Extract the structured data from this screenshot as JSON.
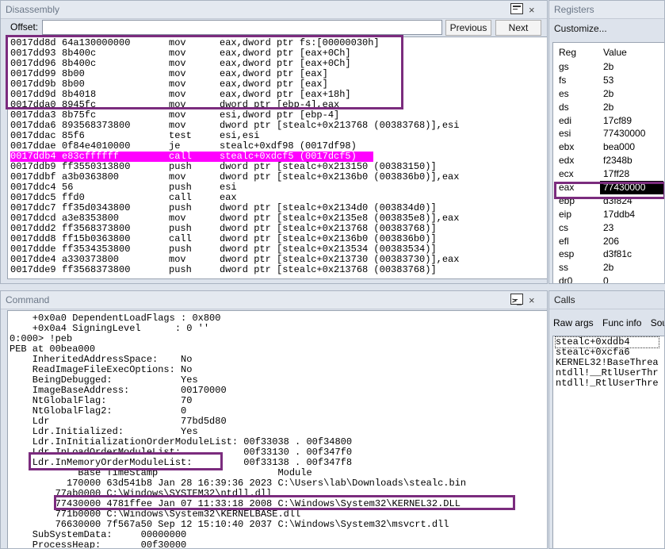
{
  "disassembly": {
    "title": "Disassembly",
    "offset_label": "Offset:",
    "offset_value": "",
    "previous_label": "Previous",
    "next_label": "Next",
    "rows": [
      {
        "addr": "0017dd8d",
        "bytes": "64a130000000",
        "mnem": "mov",
        "ops": "eax,dword ptr fs:[00000030h]"
      },
      {
        "addr": "0017dd93",
        "bytes": "8b400c",
        "mnem": "mov",
        "ops": "eax,dword ptr [eax+0Ch]"
      },
      {
        "addr": "0017dd96",
        "bytes": "8b400c",
        "mnem": "mov",
        "ops": "eax,dword ptr [eax+0Ch]"
      },
      {
        "addr": "0017dd99",
        "bytes": "8b00",
        "mnem": "mov",
        "ops": "eax,dword ptr [eax]"
      },
      {
        "addr": "0017dd9b",
        "bytes": "8b00",
        "mnem": "mov",
        "ops": "eax,dword ptr [eax]"
      },
      {
        "addr": "0017dd9d",
        "bytes": "8b4018",
        "mnem": "mov",
        "ops": "eax,dword ptr [eax+18h]"
      },
      {
        "addr": "0017dda0",
        "bytes": "8945fc",
        "mnem": "mov",
        "ops": "dword ptr [ebp-4],eax"
      },
      {
        "addr": "0017dda3",
        "bytes": "8b75fc",
        "mnem": "mov",
        "ops": "esi,dword ptr [ebp-4]"
      },
      {
        "addr": "0017dda6",
        "bytes": "893568373800",
        "mnem": "mov",
        "ops": "dword ptr [stealc+0x213768 (00383768)],esi"
      },
      {
        "addr": "0017ddac",
        "bytes": "85f6",
        "mnem": "test",
        "ops": "esi,esi"
      },
      {
        "addr": "0017ddae",
        "bytes": "0f84e4010000",
        "mnem": "je",
        "ops": "stealc+0xdf98 (0017df98)"
      },
      {
        "addr": "0017ddb4",
        "bytes": "e83cffffff",
        "mnem": "call",
        "ops": "stealc+0xdcf5 (0017dcf5)"
      },
      {
        "addr": "0017ddb9",
        "bytes": "ff3550313800",
        "mnem": "push",
        "ops": "dword ptr [stealc+0x213150 (00383150)]"
      },
      {
        "addr": "0017ddbf",
        "bytes": "a3b0363800",
        "mnem": "mov",
        "ops": "dword ptr [stealc+0x2136b0 (003836b0)],eax"
      },
      {
        "addr": "0017ddc4",
        "bytes": "56",
        "mnem": "push",
        "ops": "esi"
      },
      {
        "addr": "0017ddc5",
        "bytes": "ffd0",
        "mnem": "call",
        "ops": "eax"
      },
      {
        "addr": "0017ddc7",
        "bytes": "ff35d0343800",
        "mnem": "push",
        "ops": "dword ptr [stealc+0x2134d0 (003834d0)]"
      },
      {
        "addr": "0017ddcd",
        "bytes": "a3e8353800",
        "mnem": "mov",
        "ops": "dword ptr [stealc+0x2135e8 (003835e8)],eax"
      },
      {
        "addr": "0017ddd2",
        "bytes": "ff3568373800",
        "mnem": "push",
        "ops": "dword ptr [stealc+0x213768 (00383768)]"
      },
      {
        "addr": "0017ddd8",
        "bytes": "ff15b0363800",
        "mnem": "call",
        "ops": "dword ptr [stealc+0x2136b0 (003836b0)]"
      },
      {
        "addr": "0017ddde",
        "bytes": "ff3534353800",
        "mnem": "push",
        "ops": "dword ptr [stealc+0x213534 (00383534)]"
      },
      {
        "addr": "0017dde4",
        "bytes": "a330373800",
        "mnem": "mov",
        "ops": "dword ptr [stealc+0x213730 (00383730)],eax"
      },
      {
        "addr": "0017dde9",
        "bytes": "ff3568373800",
        "mnem": "push",
        "ops": "dword ptr [stealc+0x213768 (00383768)]"
      }
    ],
    "highlight_color": "#ff00ff",
    "annotation_color": "#7b2c7e"
  },
  "registers": {
    "title": "Registers",
    "customize_label": "Customize...",
    "col_reg": "Reg",
    "col_value": "Value",
    "rows": [
      {
        "reg": "gs",
        "value": "2b"
      },
      {
        "reg": "fs",
        "value": "53"
      },
      {
        "reg": "es",
        "value": "2b"
      },
      {
        "reg": "ds",
        "value": "2b"
      },
      {
        "reg": "edi",
        "value": "17cf89"
      },
      {
        "reg": "esi",
        "value": "77430000"
      },
      {
        "reg": "ebx",
        "value": "bea000"
      },
      {
        "reg": "edx",
        "value": "f2348b"
      },
      {
        "reg": "ecx",
        "value": "17ff28"
      },
      {
        "reg": "eax",
        "value": "77430000"
      },
      {
        "reg": "ebp",
        "value": "d3f824"
      },
      {
        "reg": "eip",
        "value": "17ddb4"
      },
      {
        "reg": "cs",
        "value": "23"
      },
      {
        "reg": "efl",
        "value": "206"
      },
      {
        "reg": "esp",
        "value": "d3f81c"
      },
      {
        "reg": "ss",
        "value": "2b"
      },
      {
        "reg": "dr0",
        "value": "0"
      }
    ]
  },
  "command": {
    "title": "Command",
    "lines": [
      "    +0x0a0 DependentLoadFlags : 0x800",
      "    +0x0a4 SigningLevel      : 0 ''",
      "0:000> !peb",
      "PEB at 00bea000",
      "    InheritedAddressSpace:    No",
      "    ReadImageFileExecOptions: No",
      "    BeingDebugged:            Yes",
      "    ImageBaseAddress:         00170000",
      "    NtGlobalFlag:             70",
      "    NtGlobalFlag2:            0",
      "    Ldr                       77bd5d80",
      "    Ldr.Initialized:          Yes",
      "    Ldr.InInitializationOrderModuleList: 00f33038 . 00f34800",
      "    Ldr.InLoadOrderModuleList:           00f33130 . 00f347f0",
      "    Ldr.InMemoryOrderModuleList:         00f33138 . 00f347f8",
      "            Base TimeStamp                     Module",
      "          170000 63d541b8 Jan 28 16:39:36 2023 C:\\Users\\lab\\Downloads\\stealc.bin",
      "        77ab0000 C:\\Windows\\SYSTEM32\\ntdll.dll",
      "        77430000 4781ffee Jan 07 11:33:18 2008 C:\\Windows\\System32\\KERNEL32.DLL",
      "        771b0000 C:\\Windows\\System32\\KERNELBASE.dll",
      "        76630000 7f567a50 Sep 12 15:10:40 2037 C:\\Windows\\System32\\msvcrt.dll",
      "    SubSystemData:     00000000",
      "    ProcessHeap:       00f30000"
    ]
  },
  "calls": {
    "title": "Calls",
    "tabs": [
      "Raw args",
      "Func info",
      "Sour"
    ],
    "frames": [
      "stealc+0xddb4",
      "stealc+0xcfa6",
      "KERNEL32!BaseThrea",
      "ntdll!__RtlUserThr",
      "ntdll!_RtlUserThre"
    ]
  }
}
